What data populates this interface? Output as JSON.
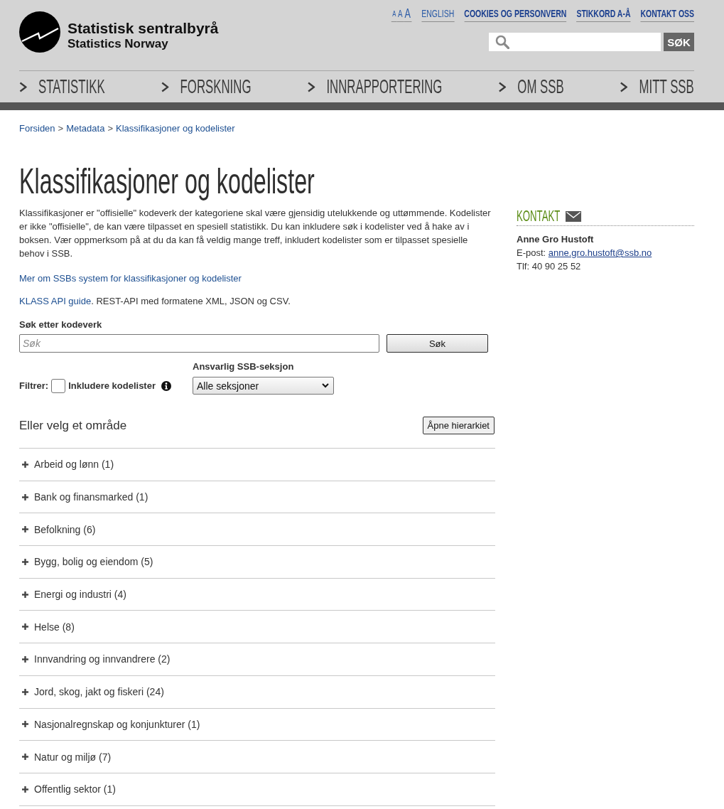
{
  "header": {
    "logo": {
      "title": "Statistisk sentralbyrå",
      "subtitle": "Statistics Norway"
    },
    "text_size": [
      "A",
      "A",
      "A"
    ],
    "top_links": [
      {
        "label": "ENGLISH",
        "kind": "language"
      },
      {
        "label": "COOKIES OG PERSONVERN",
        "kind": "link"
      },
      {
        "label": "STIKKORD A-Å",
        "kind": "link"
      },
      {
        "label": "KONTAKT OSS",
        "kind": "link"
      }
    ],
    "search": {
      "button": "SØK"
    },
    "nav": [
      {
        "label": "STATISTIKK"
      },
      {
        "label": "FORSKNING"
      },
      {
        "label": "INNRAPPORTERING"
      },
      {
        "label": "OM SSB"
      },
      {
        "label": "MITT SSB"
      }
    ]
  },
  "breadcrumb": {
    "separator": ">",
    "items": [
      "Forsiden",
      "Metadata",
      "Klassifikasjoner og kodelister"
    ]
  },
  "title": "Klassifikasjoner og kodelister",
  "intro": "Klassifikasjoner er \"offisielle\" kodeverk der kategoriene skal være gjensidig utelukkende og uttømmende. Kodelister er ikke \"offisielle\", de kan være tilpasset en spesiell statistikk. Du kan inkludere søk i kodelister ved å hake av i boksen. Vær oppmerksom på at du da kan få veldig mange treff, inkludert kodelister som er tilpasset spesielle behov i SSB.",
  "more_link": "Mer om SSBs system for klassifikasjoner og kodelister",
  "api": {
    "link": "KLASS API guide",
    "text": ". REST-API med formatene XML, JSON og CSV."
  },
  "search_form": {
    "label": "Søk etter kodeverk",
    "placeholder": "Søk",
    "button": "Søk"
  },
  "filter": {
    "label": "Filtrer:",
    "option": {
      "label": "Inkludere kodelister",
      "checked": false
    }
  },
  "section_select": {
    "label": "Ansvarlig SSB-seksjon",
    "value": "Alle seksjoner"
  },
  "areas": {
    "heading": "Eller velg et område",
    "button": "Åpne hierarkiet",
    "items": [
      {
        "label": "Arbeid og lønn (1)",
        "expanded": false
      },
      {
        "label": "Bank og finansmarked (1)",
        "expanded": false
      },
      {
        "label": "Befolkning (6)",
        "expanded": false
      },
      {
        "label": "Bygg, bolig og eiendom (5)",
        "expanded": false
      },
      {
        "label": "Energi og industri (4)",
        "expanded": false
      },
      {
        "label": "Helse (8)",
        "expanded": false
      },
      {
        "label": "Innvandring og innvandrere (2)",
        "expanded": false
      },
      {
        "label": "Jord, skog, jakt og fiskeri (24)",
        "expanded": false
      },
      {
        "label": "Nasjonalregnskap og konjunkturer (1)",
        "expanded": false
      },
      {
        "label": "Natur og miljø (7)",
        "expanded": false
      },
      {
        "label": "Offentlig sektor (1)",
        "expanded": false
      }
    ]
  },
  "contact": {
    "heading": "KONTAKT",
    "name": "Anne Gro Hustoft",
    "email_label": "E-post:",
    "email": "anne.gro.hustoft@ssb.no",
    "phone": "Tlf: 40 90 25 52"
  }
}
